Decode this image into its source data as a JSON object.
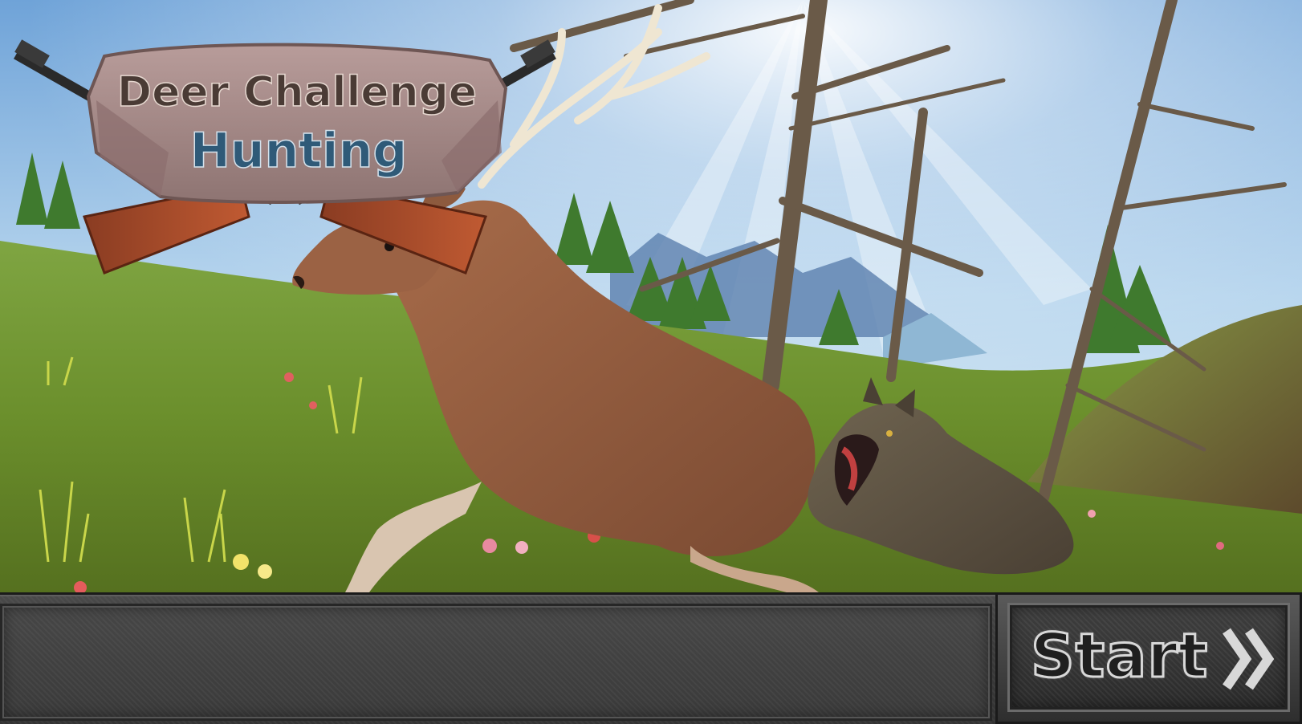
{
  "logo": {
    "line1": "Deer Challenge",
    "line2": "Hunting"
  },
  "start_button": {
    "label": "Start",
    "icon": "double-chevron-right-icon"
  },
  "colors": {
    "logo_line1": "#4a3b35",
    "logo_line2": "#2f5a78",
    "panel": "#3a3a3a"
  }
}
